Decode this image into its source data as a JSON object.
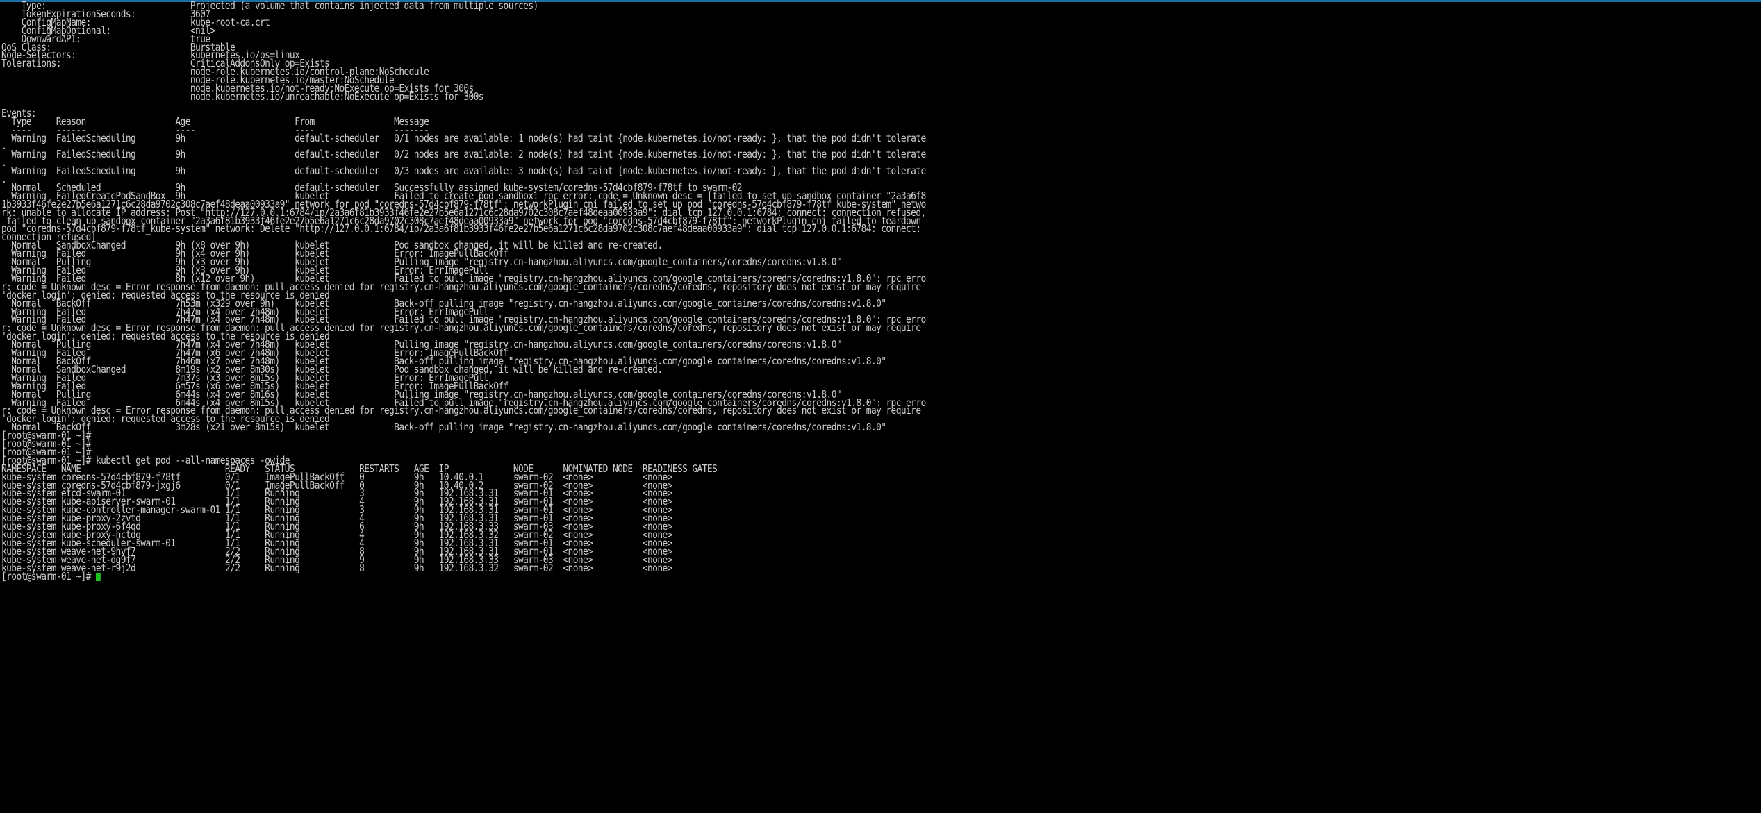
{
  "terminal": {
    "title_bar_color": "#1b6ea8",
    "background": "#000000",
    "foreground": "#cccccc",
    "cursor_color": "#20c020",
    "prompt": "[root@swarm-01 ~]#",
    "hostname": "swarm-01",
    "user": "root"
  },
  "describe_output": {
    "fields": [
      {
        "key": "    Type:",
        "value": "Projected (a volume that contains injected data from multiple sources)"
      },
      {
        "key": "    TokenExpirationSeconds:",
        "value": "3607"
      },
      {
        "key": "    ConfigMapName:",
        "value": "kube-root-ca.crt"
      },
      {
        "key": "    ConfigMapOptional:",
        "value": "<nil>"
      },
      {
        "key": "    DownwardAPI:",
        "value": "true"
      },
      {
        "key": "QoS Class:",
        "value": "Burstable"
      },
      {
        "key": "Node-Selectors:",
        "value": "kubernetes.io/os=linux"
      },
      {
        "key": "Tolerations:",
        "value": "CriticalAddonsOnly op=Exists"
      }
    ],
    "toleration_extra": [
      "node-role.kubernetes.io/control-plane:NoSchedule",
      "node-role.kubernetes.io/master:NoSchedule",
      "node.kubernetes.io/not-ready:NoExecute op=Exists for 300s",
      "node.kubernetes.io/unreachable:NoExecute op=Exists for 300s"
    ],
    "events_label": "Events:"
  },
  "events_table": {
    "headers": [
      "Type",
      "Reason",
      "Age",
      "From",
      "Message"
    ],
    "separators": [
      "----",
      "------",
      "----",
      "----",
      "-------"
    ],
    "rows": [
      {
        "type": "Warning",
        "reason": "FailedScheduling",
        "age": "9h",
        "from": "default-scheduler",
        "message": "0/1 nodes are available: 1 node(s) had taint {node.kubernetes.io/not-ready: }, that the pod didn't tolerate."
      },
      {
        "type": "Warning",
        "reason": "FailedScheduling",
        "age": "9h",
        "from": "default-scheduler",
        "message": "0/2 nodes are available: 2 node(s) had taint {node.kubernetes.io/not-ready: }, that the pod didn't tolerate."
      },
      {
        "type": "Warning",
        "reason": "FailedScheduling",
        "age": "9h",
        "from": "default-scheduler",
        "message": "0/3 nodes are available: 3 node(s) had taint {node.kubernetes.io/not-ready: }, that the pod didn't tolerate."
      },
      {
        "type": "Normal",
        "reason": "Scheduled",
        "age": "9h",
        "from": "default-scheduler",
        "message": "Successfully assigned kube-system/coredns-57d4cbf879-f78tf to swarm-02"
      },
      {
        "type": "Warning",
        "reason": "FailedCreatePodSandBox",
        "age": "9h",
        "from": "kubelet",
        "message": "Failed to create pod sandbox: rpc error: code = Unknown desc = [failed to set up sandbox container \"2a3a6f81b3933f46fe2e27b5e6a1271c6c28da9702c308c7aef48deaa00933a9\" network for pod \"coredns-57d4cbf879-f78tf\": networkPlugin cni failed to set up pod \"coredns-57d4cbf879-f78tf_kube-system\" network: unable to allocate IP address: Post \"http://127.0.0.1:6784/ip/2a3a6f81b3933f46fe2e27b5e6a1271c6c28da9702c308c7aef48deaa00933a9\": dial tcp 127.0.0.1:6784: connect: connection refused, failed to clean up sandbox container \"2a3a6f81b3933f46fe2e27b5e6a1271c6c28da9702c308c7aef48deaa00933a9\" network for pod \"coredns-57d4cbf879-f78tf\": networkPlugin cni failed to teardown pod \"coredns-57d4cbf879-f78tf_kube-system\" network: Delete \"http://127.0.0.1:6784/ip/2a3a6f81b3933f46fe2e27b5e6a1271c6c28da9702c308c7aef48deaa00933a9\": dial tcp 127.0.0.1:6784: connect: connection refused]"
      },
      {
        "type": "Normal",
        "reason": "SandboxChanged",
        "age": "9h (x8 over 9h)",
        "from": "kubelet",
        "message": "Pod sandbox changed, it will be killed and re-created."
      },
      {
        "type": "Warning",
        "reason": "Failed",
        "age": "9h (x4 over 9h)",
        "from": "kubelet",
        "message": "Error: ImagePullBackOff"
      },
      {
        "type": "Normal",
        "reason": "Pulling",
        "age": "9h (x3 over 9h)",
        "from": "kubelet",
        "message": "Pulling image \"registry.cn-hangzhou.aliyuncs.com/google_containers/coredns/coredns:v1.8.0\""
      },
      {
        "type": "Warning",
        "reason": "Failed",
        "age": "9h (x3 over 9h)",
        "from": "kubelet",
        "message": "Error: ErrImagePull"
      },
      {
        "type": "Warning",
        "reason": "Failed",
        "age": "8h (x12 over 9h)",
        "from": "kubelet",
        "message": "Failed to pull image \"registry.cn-hangzhou.aliyuncs.com/google_containers/coredns/coredns:v1.8.0\": rpc error: code = Unknown desc = Error response from daemon: pull access denied for registry.cn-hangzhou.aliyuncs.com/google_containers/coredns/coredns, repository does not exist or may require 'docker login': denied: requested access to the resource is denied"
      },
      {
        "type": "Normal",
        "reason": "BackOff",
        "age": "7h53m (x329 over 9h)",
        "from": "kubelet",
        "message": "Back-off pulling image \"registry.cn-hangzhou.aliyuncs.com/google_containers/coredns/coredns:v1.8.0\""
      },
      {
        "type": "Warning",
        "reason": "Failed",
        "age": "7h47m (x4 over 7h48m)",
        "from": "kubelet",
        "message": "Error: ErrImagePull"
      },
      {
        "type": "Warning",
        "reason": "Failed",
        "age": "7h47m (x4 over 7h48m)",
        "from": "kubelet",
        "message": "Failed to pull image \"registry.cn-hangzhou.aliyuncs.com/google_containers/coredns/coredns:v1.8.0\": rpc error: code = Unknown desc = Error response from daemon: pull access denied for registry.cn-hangzhou.aliyuncs.com/google_containers/coredns/coredns, repository does not exist or may require 'docker login': denied: requested access to the resource is denied"
      },
      {
        "type": "Normal",
        "reason": "Pulling",
        "age": "7h47m (x4 over 7h48m)",
        "from": "kubelet",
        "message": "Pulling image \"registry.cn-hangzhou.aliyuncs.com/google_containers/coredns/coredns:v1.8.0\""
      },
      {
        "type": "Warning",
        "reason": "Failed",
        "age": "7h47m (x6 over 7h48m)",
        "from": "kubelet",
        "message": "Error: ImagePullBackOff"
      },
      {
        "type": "Normal",
        "reason": "BackOff",
        "age": "7h46m (x7 over 7h48m)",
        "from": "kubelet",
        "message": "Back-off pulling image \"registry.cn-hangzhou.aliyuncs.com/google_containers/coredns/coredns:v1.8.0\""
      },
      {
        "type": "Normal",
        "reason": "SandboxChanged",
        "age": "8m19s (x2 over 8m30s)",
        "from": "kubelet",
        "message": "Pod sandbox changed, it will be killed and re-created."
      },
      {
        "type": "Warning",
        "reason": "Failed",
        "age": "7m37s (x3 over 8m15s)",
        "from": "kubelet",
        "message": "Error: ErrImagePull"
      },
      {
        "type": "Warning",
        "reason": "Failed",
        "age": "6m57s (x6 over 8m15s)",
        "from": "kubelet",
        "message": "Error: ImagePullBackOff"
      },
      {
        "type": "Normal",
        "reason": "Pulling",
        "age": "6m44s (x4 over 8m16s)",
        "from": "kubelet",
        "message": "Pulling image \"registry.cn-hangzhou.aliyuncs.com/google_containers/coredns/coredns:v1.8.0\""
      },
      {
        "type": "Warning",
        "reason": "Failed",
        "age": "6m44s (x4 over 8m15s)",
        "from": "kubelet",
        "message": "Failed to pull image \"registry.cn-hangzhou.aliyuncs.com/google_containers/coredns/coredns:v1.8.0\": rpc error: code = Unknown desc = Error response from daemon: pull access denied for registry.cn-hangzhou.aliyuncs.com/google_containers/coredns/coredns, repository does not exist or may require 'docker login': denied: requested access to the resource is denied"
      },
      {
        "type": "Normal",
        "reason": "BackOff",
        "age": "3m28s (x21 over 8m15s)",
        "from": "kubelet",
        "message": "Back-off pulling image \"registry.cn-hangzhou.aliyuncs.com/google_containers/coredns/coredns:v1.8.0\""
      }
    ]
  },
  "command": {
    "text": "kubectl get pod --all-namespaces -owide",
    "blank_prompts": 2
  },
  "pods_table": {
    "headers": [
      "NAMESPACE",
      "NAME",
      "READY",
      "STATUS",
      "RESTARTS",
      "AGE",
      "IP",
      "NODE",
      "NOMINATED NODE",
      "READINESS GATES"
    ],
    "rows": [
      {
        "namespace": "kube-system",
        "name": "coredns-57d4cbf879-f78tf",
        "ready": "0/1",
        "status": "ImagePullBackOff",
        "restarts": "0",
        "age": "9h",
        "ip": "10.40.0.1",
        "node": "swarm-02",
        "nominated": "<none>",
        "gates": "<none>"
      },
      {
        "namespace": "kube-system",
        "name": "coredns-57d4cbf879-jxgj6",
        "ready": "0/1",
        "status": "ImagePullBackOff",
        "restarts": "0",
        "age": "9h",
        "ip": "10.40.0.2",
        "node": "swarm-02",
        "nominated": "<none>",
        "gates": "<none>"
      },
      {
        "namespace": "kube-system",
        "name": "etcd-swarm-01",
        "ready": "1/1",
        "status": "Running",
        "restarts": "3",
        "age": "9h",
        "ip": "192.168.3.31",
        "node": "swarm-01",
        "nominated": "<none>",
        "gates": "<none>"
      },
      {
        "namespace": "kube-system",
        "name": "kube-apiserver-swarm-01",
        "ready": "1/1",
        "status": "Running",
        "restarts": "4",
        "age": "9h",
        "ip": "192.168.3.31",
        "node": "swarm-01",
        "nominated": "<none>",
        "gates": "<none>"
      },
      {
        "namespace": "kube-system",
        "name": "kube-controller-manager-swarm-01",
        "ready": "1/1",
        "status": "Running",
        "restarts": "3",
        "age": "9h",
        "ip": "192.168.3.31",
        "node": "swarm-01",
        "nominated": "<none>",
        "gates": "<none>"
      },
      {
        "namespace": "kube-system",
        "name": "kube-proxy-2zvtd",
        "ready": "1/1",
        "status": "Running",
        "restarts": "4",
        "age": "9h",
        "ip": "192.168.3.31",
        "node": "swarm-01",
        "nominated": "<none>",
        "gates": "<none>"
      },
      {
        "namespace": "kube-system",
        "name": "kube-proxy-6f4qd",
        "ready": "1/1",
        "status": "Running",
        "restarts": "6",
        "age": "9h",
        "ip": "192.168.3.33",
        "node": "swarm-03",
        "nominated": "<none>",
        "gates": "<none>"
      },
      {
        "namespace": "kube-system",
        "name": "kube-proxy-hctdg",
        "ready": "1/1",
        "status": "Running",
        "restarts": "4",
        "age": "9h",
        "ip": "192.168.3.32",
        "node": "swarm-02",
        "nominated": "<none>",
        "gates": "<none>"
      },
      {
        "namespace": "kube-system",
        "name": "kube-scheduler-swarm-01",
        "ready": "1/1",
        "status": "Running",
        "restarts": "4",
        "age": "9h",
        "ip": "192.168.3.31",
        "node": "swarm-01",
        "nominated": "<none>",
        "gates": "<none>"
      },
      {
        "namespace": "kube-system",
        "name": "weave-net-9hvf7",
        "ready": "2/2",
        "status": "Running",
        "restarts": "8",
        "age": "9h",
        "ip": "192.168.3.31",
        "node": "swarm-01",
        "nominated": "<none>",
        "gates": "<none>"
      },
      {
        "namespace": "kube-system",
        "name": "weave-net-dg9f7",
        "ready": "2/2",
        "status": "Running",
        "restarts": "9",
        "age": "9h",
        "ip": "192.168.3.33",
        "node": "swarm-03",
        "nominated": "<none>",
        "gates": "<none>"
      },
      {
        "namespace": "kube-system",
        "name": "weave-net-r9j2d",
        "ready": "2/2",
        "status": "Running",
        "restarts": "8",
        "age": "9h",
        "ip": "192.168.3.32",
        "node": "swarm-02",
        "nominated": "<none>",
        "gates": "<none>"
      }
    ]
  }
}
